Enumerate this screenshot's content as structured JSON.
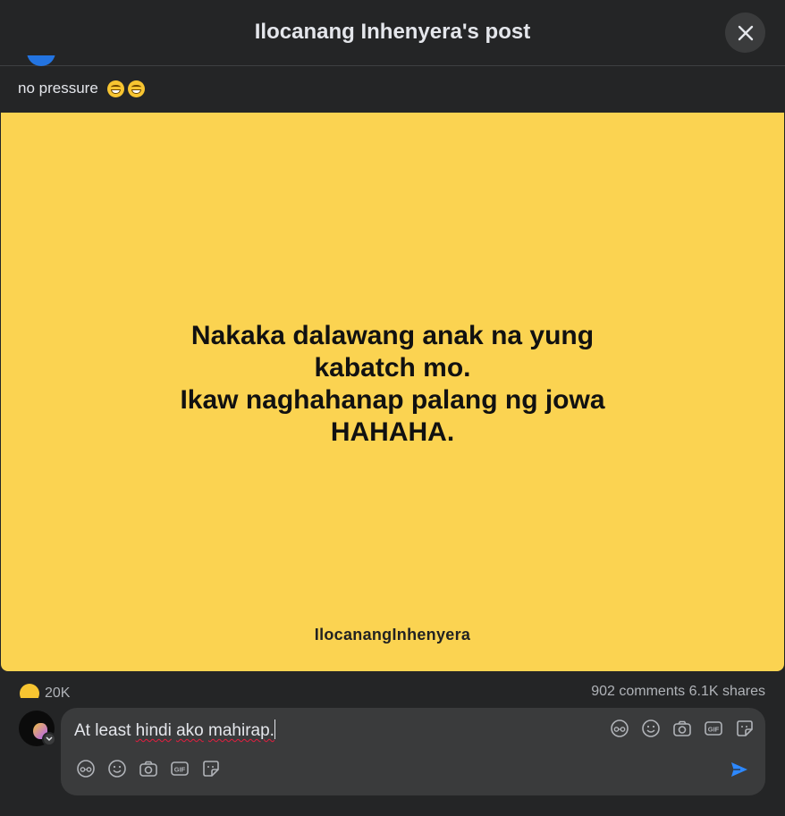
{
  "header": {
    "title": "Ilocanang Inhenyera's post"
  },
  "post": {
    "caption": "no pressure",
    "image_lines": [
      "Nakaka dalawang anak na yung",
      "kabatch mo.",
      "Ikaw naghahanap palang ng jowa",
      "HAHAHA."
    ],
    "watermark": "IlocanangInhenyera",
    "image_bg": "#fbd351"
  },
  "stats": {
    "reactions": "20K",
    "comments_shares": "902 comments  6.1K shares"
  },
  "comment": {
    "word1": "At least",
    "word2": "hindi",
    "word3": "ako",
    "word4": "mahirap."
  },
  "colors": {
    "accent": "#2d88ff",
    "panel": "#242526",
    "input": "#3a3b3c"
  },
  "icons": [
    "close-icon",
    "avatar-emoji-icon",
    "emoji-icon",
    "camera-icon",
    "gif-icon",
    "sticker-icon",
    "send-icon"
  ]
}
